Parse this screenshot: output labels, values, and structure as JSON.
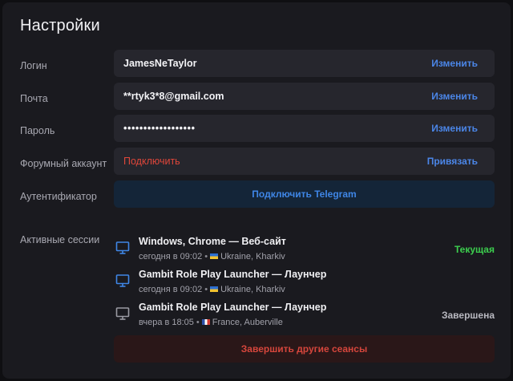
{
  "page": {
    "title": "Настройки"
  },
  "account": {
    "login": {
      "label": "Логин",
      "value": "JamesNeTaylor",
      "action": "Изменить"
    },
    "email": {
      "label": "Почта",
      "value": "**rtyk3*8@gmail.com",
      "action": "Изменить"
    },
    "password": {
      "label": "Пароль",
      "value": "••••••••••••••••••",
      "action": "Изменить"
    },
    "forum": {
      "label": "Форумный аккаунт",
      "value": "Подключить",
      "action": "Привязать"
    },
    "authenticator": {
      "label": "Аутентификатор",
      "button": "Подключить Telegram"
    }
  },
  "sessions": {
    "label": "Активные сессии",
    "items": [
      {
        "name": "Windows, Chrome — Веб-сайт",
        "time": "сегодня в 09:02",
        "location": "Ukraine, Kharkiv",
        "flag": "ukraine-flag",
        "status": "Текущая",
        "status_color": "#3ccf4e",
        "icon_color": "#3f86e6"
      },
      {
        "name": "Gambit Role Play Launcher — Лаунчер",
        "time": "сегодня в 09:02",
        "location": "Ukraine, Kharkiv",
        "flag": "ukraine-flag",
        "status": "",
        "status_color": "#3ccf4e",
        "icon_color": "#3f86e6"
      },
      {
        "name": "Gambit Role Play Launcher — Лаунчер",
        "time": "вчера в 18:05",
        "location": "France, Auberville",
        "flag": "france-flag",
        "status": "Завершена",
        "status_color": "#b9b9c0",
        "icon_color": "#9a9aa2"
      }
    ],
    "end_others": "Завершить другие сеансы"
  },
  "colors": {
    "accent": "#4b86e8",
    "danger": "#e0463a",
    "current": "#3ccf4e",
    "background": "#1a1a1f",
    "field": "#26262d"
  }
}
